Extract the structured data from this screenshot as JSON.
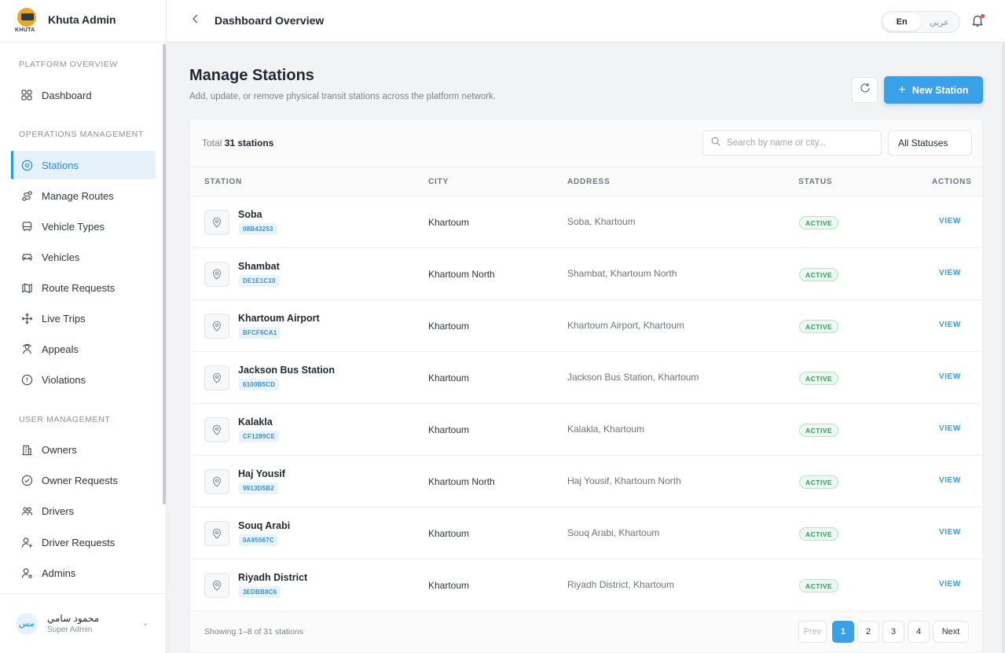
{
  "brand": {
    "logo_text": "KHUTA",
    "title": "Khuta Admin"
  },
  "sidebar": {
    "sections": [
      {
        "label": "PLATFORM OVERVIEW"
      },
      {
        "label": "OPERATIONS MANAGEMENT"
      },
      {
        "label": "USER MANAGEMENT"
      }
    ],
    "items": [
      {
        "label": "Dashboard",
        "icon": "grid-icon"
      },
      {
        "label": "Stations",
        "icon": "map-pin-icon",
        "active": true
      },
      {
        "label": "Manage Routes",
        "icon": "route-icon"
      },
      {
        "label": "Vehicle Types",
        "icon": "bus-icon"
      },
      {
        "label": "Vehicles",
        "icon": "car-icon"
      },
      {
        "label": "Route Requests",
        "icon": "map-icon"
      },
      {
        "label": "Live Trips",
        "icon": "move-icon"
      },
      {
        "label": "Appeals",
        "icon": "users-group-icon"
      },
      {
        "label": "Violations",
        "icon": "alert-circle-icon"
      },
      {
        "label": "Owners",
        "icon": "building-icon"
      },
      {
        "label": "Owner Requests",
        "icon": "check-circle-icon"
      },
      {
        "label": "Drivers",
        "icon": "users-icon"
      },
      {
        "label": "Driver Requests",
        "icon": "user-plus-icon"
      },
      {
        "label": "Admins",
        "icon": "user-cog-icon"
      }
    ]
  },
  "user": {
    "initials": "مس",
    "name": "محمود سامي",
    "role": "Super Admin"
  },
  "topbar": {
    "title": "Dashboard Overview",
    "lang_en": "En",
    "lang_ar": "عربي"
  },
  "page": {
    "title": "Manage Stations",
    "subtitle": "Add, update, or remove physical transit stations across the platform network.",
    "new_button": "New Station"
  },
  "toolbar": {
    "total_prefix": "Total",
    "total_value": "31 stations",
    "search_placeholder": "Search by name or city...",
    "status_filter": "All Statuses"
  },
  "table": {
    "headers": {
      "station": "STATION",
      "city": "CITY",
      "address": "ADDRESS",
      "status": "STATUS",
      "actions": "ACTIONS"
    },
    "rows": [
      {
        "name": "Soba",
        "code": "08B43253",
        "city": "Khartoum",
        "address": "Soba, Khartoum",
        "status": "ACTIVE",
        "action": "VIEW"
      },
      {
        "name": "Shambat",
        "code": "DE1E1C10",
        "city": "Khartoum North",
        "address": "Shambat, Khartoum North",
        "status": "ACTIVE",
        "action": "VIEW"
      },
      {
        "name": "Khartoum Airport",
        "code": "BFCF6CA1",
        "city": "Khartoum",
        "address": "Khartoum Airport, Khartoum",
        "status": "ACTIVE",
        "action": "VIEW"
      },
      {
        "name": "Jackson Bus Station",
        "code": "6100B5CD",
        "city": "Khartoum",
        "address": "Jackson Bus Station, Khartoum",
        "status": "ACTIVE",
        "action": "VIEW"
      },
      {
        "name": "Kalakla",
        "code": "CF1289CE",
        "city": "Khartoum",
        "address": "Kalakla, Khartoum",
        "status": "ACTIVE",
        "action": "VIEW"
      },
      {
        "name": "Haj Yousif",
        "code": "9913D5B2",
        "city": "Khartoum North",
        "address": "Haj Yousif, Khartoum North",
        "status": "ACTIVE",
        "action": "VIEW"
      },
      {
        "name": "Souq Arabi",
        "code": "0A95567C",
        "city": "Khartoum",
        "address": "Souq Arabi, Khartoum",
        "status": "ACTIVE",
        "action": "VIEW"
      },
      {
        "name": "Riyadh District",
        "code": "3EDBB8C6",
        "city": "Khartoum",
        "address": "Riyadh District, Khartoum",
        "status": "ACTIVE",
        "action": "VIEW"
      }
    ]
  },
  "pagination": {
    "showing": "Showing 1–8 of 31 stations",
    "prev": "Prev",
    "next": "Next",
    "pages": [
      "1",
      "2",
      "3",
      "4"
    ],
    "current": "1"
  },
  "colors": {
    "accent": "#3aa0e8",
    "active_green": "#2e9d58",
    "sidebar_active_bg": "#e6f2fb"
  }
}
